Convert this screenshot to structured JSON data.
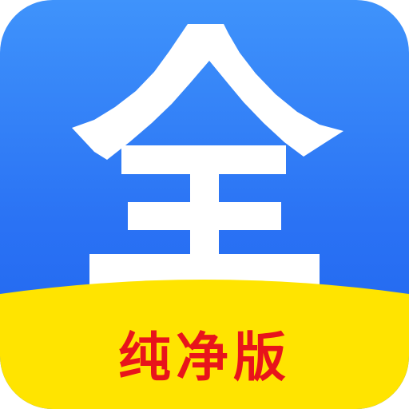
{
  "app_icon": {
    "main_character": "全",
    "badge_label": "纯净版"
  },
  "colors": {
    "tile_top": "#3f93fb",
    "tile_bottom": "#1e62ee",
    "glyph": "#ffffff",
    "band": "#ffe400",
    "badge_text": "#e8141b"
  }
}
